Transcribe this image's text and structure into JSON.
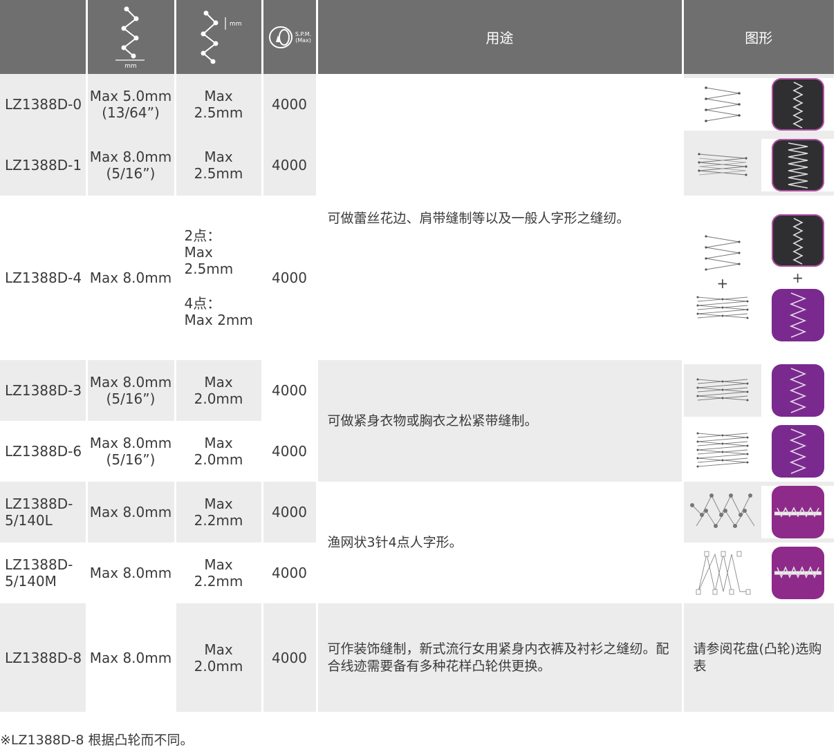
{
  "header": {
    "col_use": "用途",
    "col_figure": "图形",
    "col_spm_1": "S.P.M.",
    "col_spm_2": "(Max)",
    "mm": "mm"
  },
  "rows": [
    {
      "model": "LZ1388D-0",
      "width": "Max 5.0mm",
      "width2": "(13/64”)",
      "pitch": "Max",
      "pitch2": "2.5mm",
      "spm": "4000"
    },
    {
      "model": "LZ1388D-1",
      "width": "Max 8.0mm",
      "width2": "(5/16”)",
      "pitch": "Max",
      "pitch2": "2.5mm",
      "spm": "4000"
    },
    {
      "model": "LZ1388D-4",
      "width": "Max 8.0mm",
      "pitch_a": "2点：",
      "pitch_b": "Max 2.5mm",
      "pitch_c": "4点：",
      "pitch_d": "Max 2mm",
      "spm": "4000"
    },
    {
      "model": "LZ1388D-3",
      "width": "Max 8.0mm",
      "width2": "(5/16”)",
      "pitch": "Max",
      "pitch2": "2.0mm",
      "spm": "4000"
    },
    {
      "model": "LZ1388D-6",
      "width": "Max 8.0mm",
      "width2": "(5/16”)",
      "pitch": "Max",
      "pitch2": "2.0mm",
      "spm": "4000"
    },
    {
      "model": "LZ1388D-",
      "model2": "5/140L",
      "width": "Max 8.0mm",
      "pitch": "Max",
      "pitch2": "2.2mm",
      "spm": "4000"
    },
    {
      "model": "LZ1388D-",
      "model2": "5/140M",
      "width": "Max 8.0mm",
      "pitch": "Max",
      "pitch2": "2.2mm",
      "spm": "4000"
    },
    {
      "model": "LZ1388D-8",
      "width": "Max 8.0mm",
      "pitch": "Max",
      "pitch2": "2.0mm",
      "spm": "4000"
    }
  ],
  "uses": {
    "group1": "可做蕾丝花边、肩带缝制等以及一般人字形之缝纫。",
    "group2": "可做紧身衣物或胸衣之松紧带缝制。",
    "group3": "渔网状3针4点人字形。",
    "group4": "可作装饰缝制，新式流行女用紧身内衣裤及衬衫之缝纫。配合线迹需要备有多种花样凸轮供更换。"
  },
  "pattern_note": "请参阅花盘(凸轮)选购表",
  "plus": "+",
  "footnote": "※LZ1388D-8 根据凸轮而不同。",
  "colors": {
    "header": "#6f6f6f",
    "grey_row": "#ececec",
    "dark_fabric": "#2f2f32",
    "purple_fabric": "#7a2a8e"
  }
}
